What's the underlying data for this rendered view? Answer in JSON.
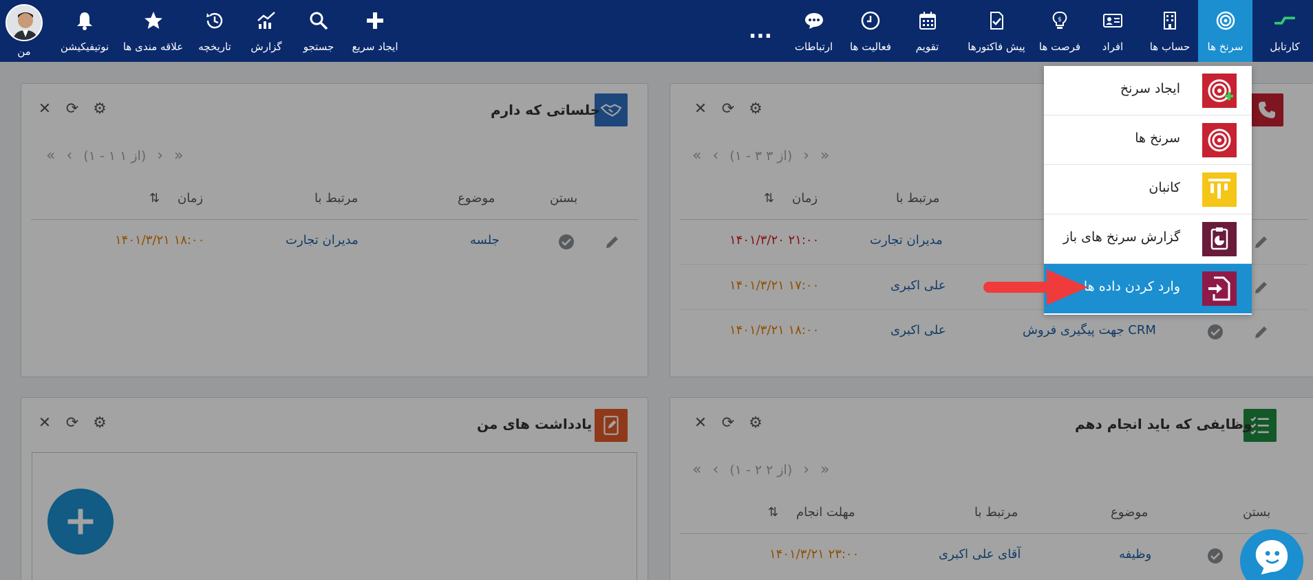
{
  "nav": {
    "right_items": [
      {
        "label": "کارتابل",
        "icon": "kartable-icon"
      },
      {
        "label": "سرنخ ها",
        "icon": "target-icon"
      },
      {
        "label": "حساب ها",
        "icon": "building-icon"
      },
      {
        "label": "افراد",
        "icon": "contact-card-icon"
      },
      {
        "label": "فرصت ها",
        "icon": "lightbulb-icon"
      },
      {
        "label": "پیش فاکتورها",
        "icon": "invoice-icon"
      },
      {
        "label": "تقویم",
        "icon": "calendar-icon"
      },
      {
        "label": "فعالیت ها",
        "icon": "clock-icon"
      },
      {
        "label": "ارتباطات",
        "icon": "chat-icon"
      }
    ],
    "more": "...",
    "left_items": [
      {
        "label": "ایجاد سریع",
        "icon": "plus-icon"
      },
      {
        "label": "جستجو",
        "icon": "search-icon"
      },
      {
        "label": "گزارش",
        "icon": "chart-icon"
      },
      {
        "label": "تاریخچه",
        "icon": "history-icon"
      },
      {
        "label": "علاقه مندی ها",
        "icon": "star-icon"
      },
      {
        "label": "نوتیفیکیشن",
        "icon": "bell-icon"
      },
      {
        "label": "من",
        "icon": "avatar-icon"
      }
    ]
  },
  "dropdown": {
    "items": [
      {
        "label": "ایجاد سرنخ",
        "icon": "create-lead-icon",
        "color": "#c62232"
      },
      {
        "label": "سرنخ ها",
        "icon": "leads-icon",
        "color": "#c62232"
      },
      {
        "label": "کانبان",
        "icon": "kanban-icon",
        "color": "#f5c518"
      },
      {
        "label": "گزارش سرنخ های باز",
        "icon": "report-icon",
        "color": "#6a1b3a"
      },
      {
        "label": "وارد کردن داده ها",
        "icon": "import-icon",
        "color": "#8e1a4a"
      }
    ]
  },
  "widgets": {
    "calls": {
      "pager": "(۱ - ۳ از ۳)",
      "headers": {
        "related": "مرتبط با",
        "time": "زمان"
      },
      "rows": [
        {
          "related": "مدیران تجارت",
          "time": "۱۴۰۱/۳/۲۰ ۲۱:۰۰"
        },
        {
          "related": "علی اکبری",
          "time": "۱۴۰۱/۳/۲۱ ۱۷:۰۰"
        },
        {
          "subject": "جهت پیگیری فروش CRM",
          "related": "علی اکبری",
          "time": "۱۴۰۱/۳/۲۱ ۱۸:۰۰"
        }
      ]
    },
    "meetings": {
      "title": "جلساتی که دارم",
      "pager": "(۱ - ۱ از ۱)",
      "headers": {
        "close": "بستن",
        "subject": "موضوع",
        "related": "مرتبط با",
        "time": "زمان"
      },
      "rows": [
        {
          "subject": "جلسه",
          "related": "مدیران تجارت",
          "time": "۱۴۰۱/۳/۲۱ ۱۸:۰۰"
        }
      ]
    },
    "tasks": {
      "title": "وظایفی که باید انجام دهم",
      "pager": "(۱ - ۲ از ۲)",
      "headers": {
        "close": "بستن",
        "subject": "موضوع",
        "related": "مرتبط با",
        "deadline": "مهلت انجام"
      },
      "rows": [
        {
          "subject": "وظیفه",
          "related": "آقای علی اکبری",
          "deadline": "۱۴۰۱/۳/۲۱ ۲۳:۰۰"
        }
      ]
    },
    "notes": {
      "title": "یادداشت های من"
    }
  },
  "colors": {
    "nav_bg": "#0b2a6b",
    "accent": "#1b8fd0",
    "link": "#1a5fa0",
    "time_orange": "#e07b00",
    "time_red": "#d11a1a"
  }
}
